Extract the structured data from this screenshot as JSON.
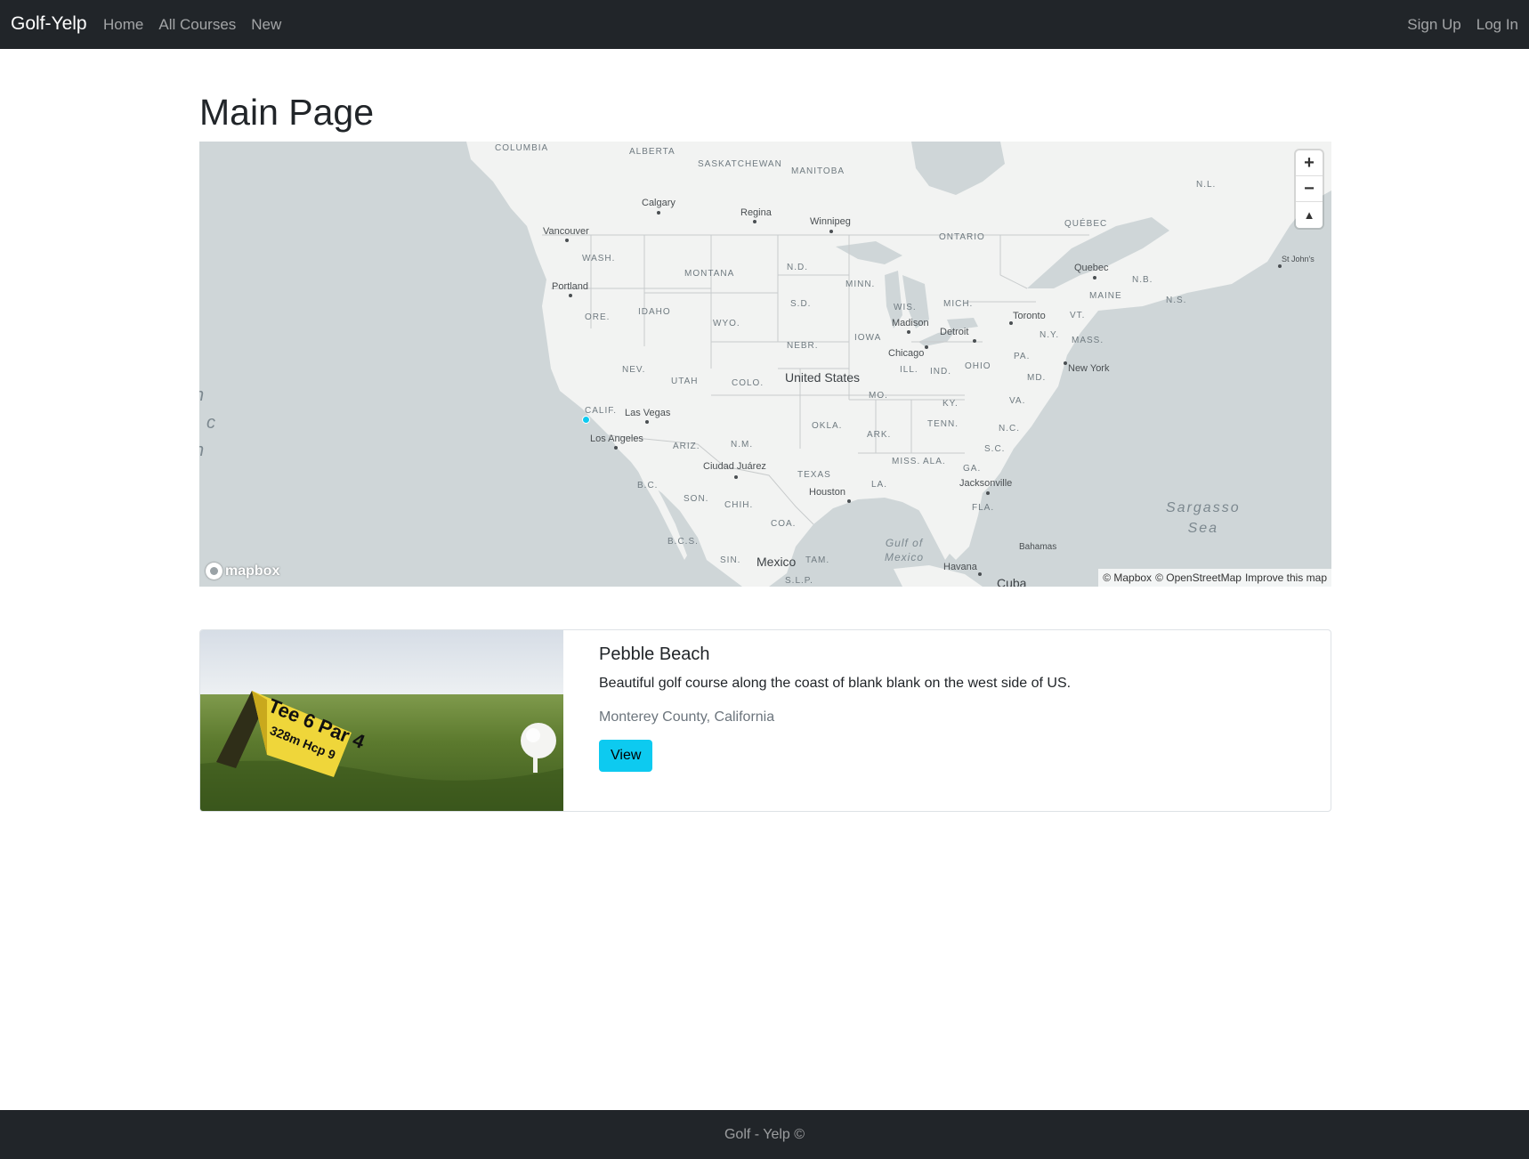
{
  "navbar": {
    "brand": "Golf-Yelp",
    "left_links": [
      "Home",
      "All Courses",
      "New"
    ],
    "right_links": [
      "Sign Up",
      "Log In"
    ]
  },
  "page": {
    "title": "Main Page"
  },
  "map": {
    "regions": [
      "COLUMBIA",
      "ALBERTA",
      "SASKATCHEWAN",
      "MANITOBA",
      "ONTARIO",
      "QUÉBEC",
      "N.L.",
      "N.B.",
      "N.S.",
      "WASH.",
      "MONTANA",
      "N.D.",
      "MINN.",
      "WIS.",
      "MICH.",
      "ORE.",
      "IDAHO",
      "WYO.",
      "S.D.",
      "IOWA",
      "NEBR.",
      "NEV.",
      "UTAH",
      "COLO.",
      "ILL.",
      "IND.",
      "OHIO",
      "PA.",
      "N.Y.",
      "MASS.",
      "MAINE",
      "VT.",
      "MO.",
      "KY.",
      "VA.",
      "MD.",
      "CALIF.",
      "ARIZ.",
      "N.M.",
      "OKLA.",
      "ARK.",
      "TENN.",
      "N.C.",
      "S.C.",
      "TEXAS",
      "MISS.",
      "ALA.",
      "GA.",
      "LA.",
      "FLA.",
      "B.C.",
      "SON.",
      "CHIH.",
      "COA.",
      "B.C.S.",
      "SIN.",
      "TAM.",
      "S.L.P."
    ],
    "cities": [
      "Calgary",
      "Regina",
      "Winnipeg",
      "Vancouver",
      "Portland",
      "Quebec",
      "St John's",
      "Toronto",
      "Madison",
      "Detroit",
      "Chicago",
      "New York",
      "Las Vegas",
      "Los Angeles",
      "Ciudad Juárez",
      "Houston",
      "Jacksonville",
      "Havana",
      "Bahamas"
    ],
    "countries": [
      "United States",
      "Mexico",
      "Cuba"
    ],
    "water": {
      "sargasso": "Sargasso\nSea",
      "gulf": "Gulf of\nMexico",
      "pacific_fragment": "h\ni c\nn"
    },
    "controls": {
      "zoom_in": "+",
      "zoom_out": "−",
      "compass": "▲"
    },
    "logo": "mapbox",
    "attribution": [
      "© Mapbox",
      "© OpenStreetMap",
      "Improve this map"
    ],
    "marker_color": "#0dcaf0"
  },
  "course": {
    "title": "Pebble Beach",
    "description": "Beautiful golf course along the coast of blank blank on the west side of US.",
    "location": "Monterey County, California",
    "button": "View",
    "image_sign_line1": "Tee 6 Par 4",
    "image_sign_line2": "328m Hcp 9"
  },
  "footer": {
    "text": "Golf - Yelp ©"
  },
  "colors": {
    "navbar": "#212529",
    "accent": "#0dcaf0",
    "map_water": "#cfd6d8",
    "map_land": "#f2f3f2"
  }
}
